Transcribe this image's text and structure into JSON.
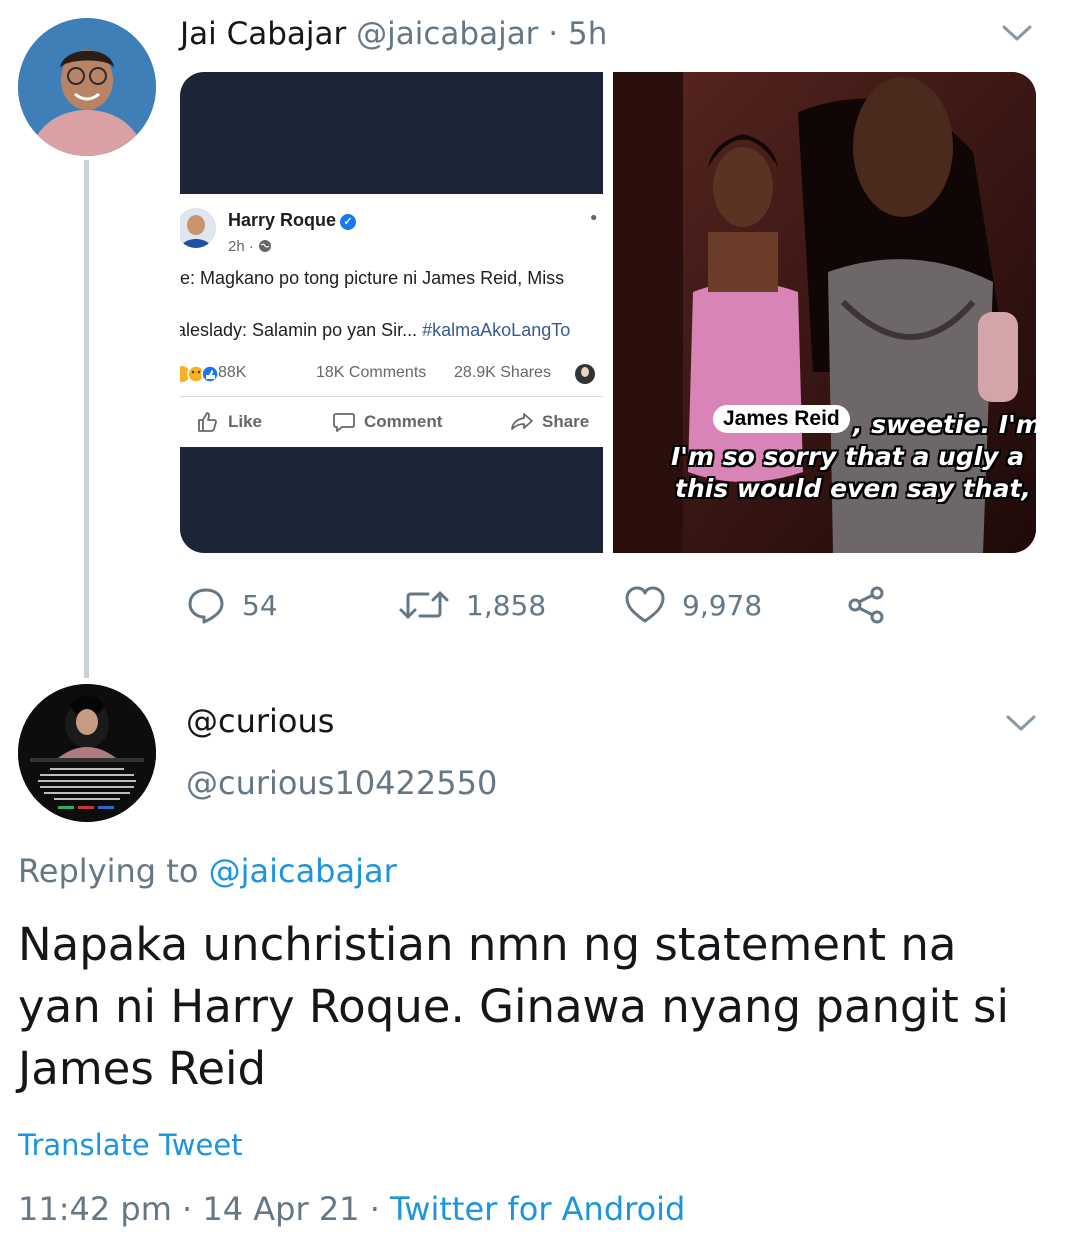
{
  "tweet1": {
    "author_name": "Jai Cabajar",
    "author_handle": "@jaicabajar",
    "separator": "·",
    "time": "5h",
    "media": {
      "fb_post": {
        "name": "Harry Roque",
        "time": "2h ·",
        "line1": "le: Magkano po tong picture ni James Reid, Miss",
        "line2_text": "aleslady: Salamin po yan Sir... ",
        "line2_hashtag": "#kalmaAkoLangTo",
        "reactions_count": "88K",
        "comments": "18K Comments",
        "shares": "28.9K Shares",
        "actions": [
          "Like",
          "Comment",
          "Share"
        ]
      },
      "meme": {
        "tag": "James Reid",
        "line1": ", sweetie. I'm",
        "line2": "I'm so sorry that a ugly a",
        "line3": "this would even say that,"
      }
    },
    "replies": "54",
    "retweets": "1,858",
    "likes": "9,978"
  },
  "tweet2": {
    "author_name": "@curious",
    "author_handle": "@curious10422550",
    "replying_prefix": "Replying to ",
    "replying_to": "@jaicabajar",
    "text": "Napaka unchristian nmn ng statement na yan ni Harry Roque. Ginawa nyang pangit si James Reid",
    "translate_label": "Translate Tweet",
    "time": "11:42 pm",
    "date": "14 Apr 21",
    "source": "Twitter for Android"
  },
  "colors": {
    "text": "#14171a",
    "secondary": "#657786",
    "link": "#1b95e0",
    "thread_line": "#c9d1d8",
    "fb_blue": "#1877f2"
  },
  "icons": [
    "chevron-down-icon",
    "reply-icon",
    "retweet-icon",
    "like-icon",
    "share-icon",
    "verified-icon"
  ]
}
